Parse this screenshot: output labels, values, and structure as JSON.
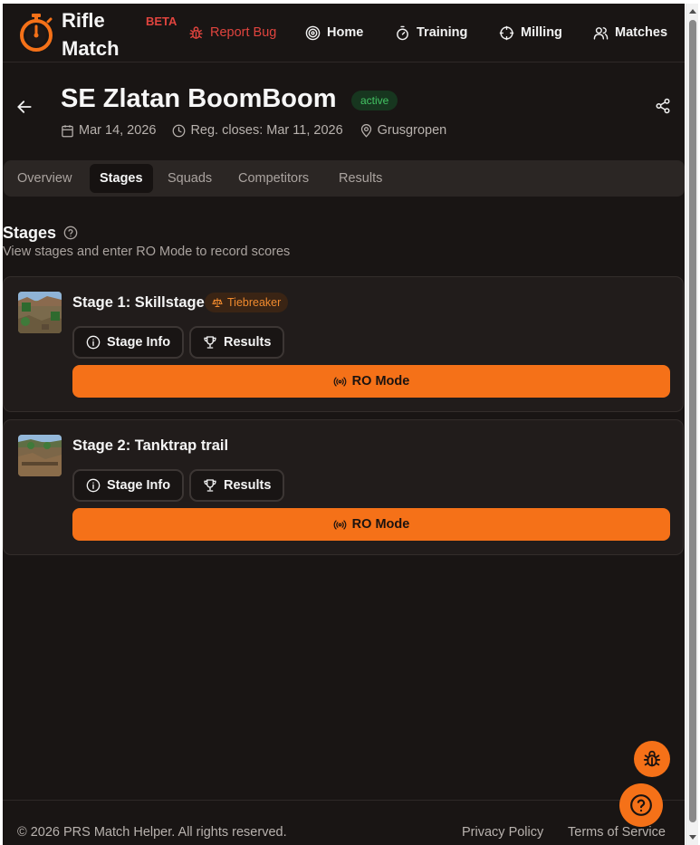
{
  "header": {
    "brand_line1": "Rifle",
    "brand_line2": "Match",
    "beta": "BETA",
    "report_bug": "Report Bug",
    "nav": {
      "home": "Home",
      "training": "Training",
      "milling": "Milling",
      "matches": "Matches"
    }
  },
  "match": {
    "title": "SE Zlatan BoomBoom",
    "status": "active",
    "date": "Mar 14, 2026",
    "reg_closes": "Reg. closes: Mar 11, 2026",
    "location": "Grusgropen"
  },
  "tabs": [
    "Overview",
    "Stages",
    "Squads",
    "Competitors",
    "Results"
  ],
  "stages_section": {
    "title": "Stages",
    "subtitle": "View stages and enter RO Mode to record scores"
  },
  "stages": [
    {
      "name": "Stage 1: Skillstage",
      "badge": "Tiebreaker",
      "info_label": "Stage Info",
      "results_label": "Results",
      "ro_label": "RO Mode"
    },
    {
      "name": "Stage 2: Tanktrap trail",
      "info_label": "Stage Info",
      "results_label": "Results",
      "ro_label": "RO Mode"
    }
  ],
  "footer": {
    "copyright": "© 2026 PRS Match Helper. All rights reserved.",
    "privacy": "Privacy Policy",
    "terms": "Terms of Service"
  },
  "colors": {
    "accent": "#f57118",
    "background": "#191514",
    "danger": "#e0443e",
    "success": "#43c463"
  }
}
